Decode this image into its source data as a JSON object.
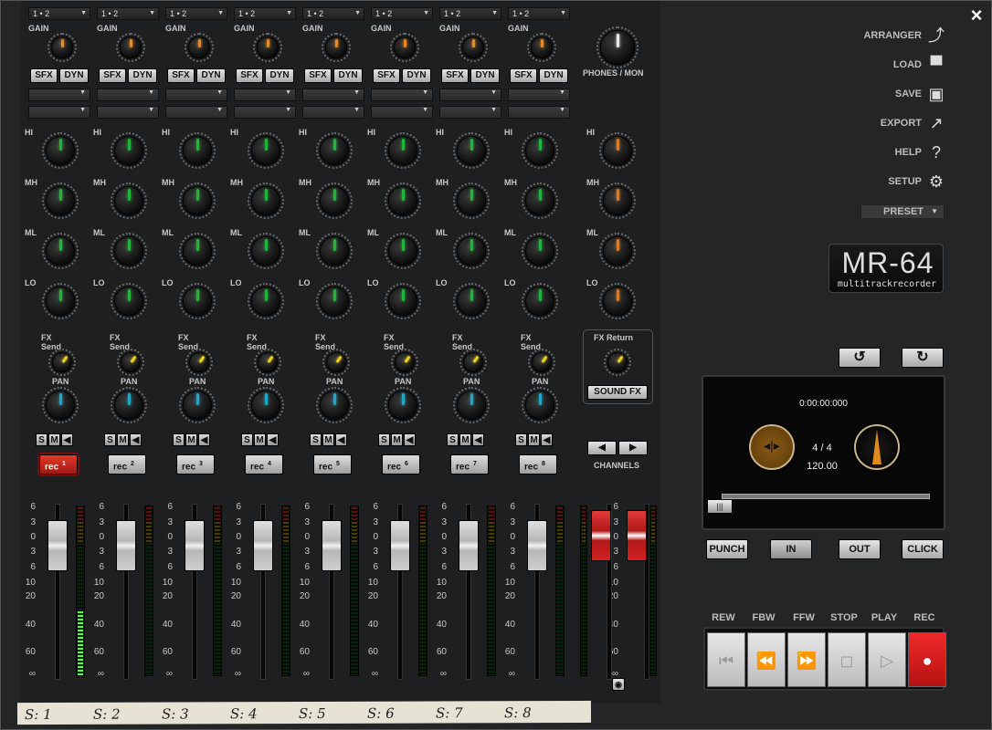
{
  "channels": [
    {
      "input": "1 • 2",
      "rec_label": "rec",
      "rec_num": "1",
      "armed": true,
      "meter": 0.38,
      "fader_pos": 0.1,
      "label": "S: 1"
    },
    {
      "input": "1 • 2",
      "rec_label": "rec",
      "rec_num": "2",
      "armed": false,
      "meter": 0,
      "fader_pos": 0.1,
      "label": "S: 2"
    },
    {
      "input": "1 • 2",
      "rec_label": "rec",
      "rec_num": "3",
      "armed": false,
      "meter": 0,
      "fader_pos": 0.1,
      "label": "S: 3"
    },
    {
      "input": "1 • 2",
      "rec_label": "rec",
      "rec_num": "4",
      "armed": false,
      "meter": 0,
      "fader_pos": 0.1,
      "label": "S: 4"
    },
    {
      "input": "1 • 2",
      "rec_label": "rec",
      "rec_num": "5",
      "armed": false,
      "meter": 0,
      "fader_pos": 0.1,
      "label": "S: 5"
    },
    {
      "input": "1 • 2",
      "rec_label": "rec",
      "rec_num": "6",
      "armed": false,
      "meter": 0,
      "fader_pos": 0.1,
      "label": "S: 6"
    },
    {
      "input": "1 • 2",
      "rec_label": "rec",
      "rec_num": "7",
      "armed": false,
      "meter": 0,
      "fader_pos": 0.1,
      "label": "S: 7"
    },
    {
      "input": "1 • 2",
      "rec_label": "rec",
      "rec_num": "8",
      "armed": false,
      "meter": 0,
      "fader_pos": 0.1,
      "label": "S: 8"
    }
  ],
  "labels": {
    "gain": "GAIN",
    "sfx": "SFX",
    "dyn": "DYN",
    "hi": "HI",
    "mh": "MH",
    "ml": "ML",
    "lo": "LO",
    "fx_send": "FX Send",
    "pan": "PAN",
    "s": "S",
    "m": "M",
    "fx_return": "FX Return",
    "sound_fx": "SOUND FX",
    "channels": "CHANNELS",
    "phones_mon": "PHONES / MON"
  },
  "scale_ticks": [
    "6",
    "3",
    "0",
    "3",
    "6",
    "10",
    "20",
    "40",
    "60",
    "∞"
  ],
  "menu": [
    {
      "label": "ARRANGER",
      "icon": "arranger-icon",
      "glyph": "⤴"
    },
    {
      "label": "LOAD",
      "icon": "folder-icon",
      "glyph": "▀"
    },
    {
      "label": "SAVE",
      "icon": "save-icon",
      "glyph": "▣"
    },
    {
      "label": "EXPORT",
      "icon": "export-icon",
      "glyph": "↗"
    },
    {
      "label": "HELP",
      "icon": "help-icon",
      "glyph": "?"
    },
    {
      "label": "SETUP",
      "icon": "gears-icon",
      "glyph": "⚙"
    }
  ],
  "preset": "PRESET",
  "logo": {
    "title": "MR-64",
    "subtitle": "multitrackrecorder"
  },
  "display": {
    "time": "0:00:00:000",
    "signature": "4 / 4",
    "tempo": "120.00"
  },
  "punch": {
    "punch": "PUNCH",
    "in": "IN",
    "out": "OUT",
    "click": "CLICK"
  },
  "transport": [
    "REW",
    "FBW",
    "FFW",
    "STOP",
    "PLAY",
    "REC"
  ],
  "close": "×",
  "colors": {
    "eq_master": "#e07a1a",
    "eq_channel": "#1fb53a",
    "gain": "#e88a1f",
    "pan": "#1fa7c8",
    "fx": "#e6d21f",
    "rec": "#e01d1d"
  }
}
